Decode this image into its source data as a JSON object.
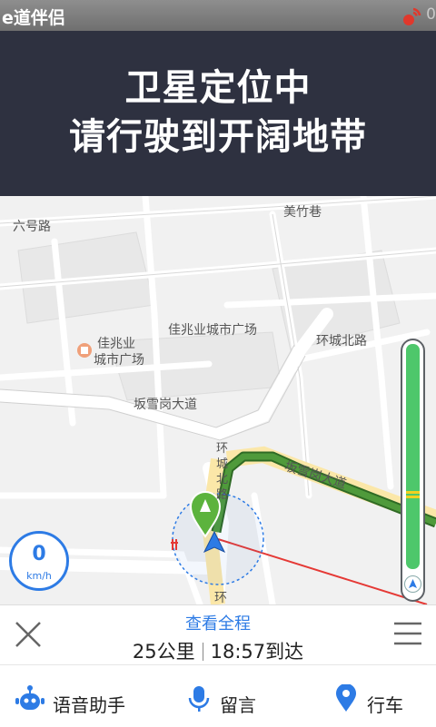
{
  "status_bar": {
    "app_name": "e道伴侣",
    "signal_count": "0"
  },
  "banner": {
    "line1": "卫星定位中",
    "line2": "请行驶到开阔地带"
  },
  "map": {
    "labels": {
      "road_liuhao": "六号路",
      "road_meizhuxiang": "美竹巷",
      "plaza_jiazhaoye": "佳兆业城市广场",
      "poi_jiazhaoye_line1": "佳兆业",
      "poi_jiazhaoye_line2": "城市广场",
      "road_huanchengbei": "环城北路",
      "road_banxuegang": "坂雪岗大道",
      "road_banxuegang_route": "坂雪岗大道",
      "road_huancheng_v": "环城北路",
      "road_huan_bottom": "环"
    },
    "route_color": "#4f9a3b"
  },
  "speedometer": {
    "value": "0",
    "unit": "km/h"
  },
  "route_progress": {
    "level": 0.88
  },
  "nav_panel": {
    "overview_label": "查看全程",
    "distance": "25公里",
    "arrival": "18:57到达"
  },
  "bottom_actions": [
    {
      "label": "语音助手",
      "icon": "robot-assistant-icon"
    },
    {
      "label": "留言",
      "icon": "microphone-icon"
    },
    {
      "label": "行车",
      "icon": "location-pin-icon"
    }
  ],
  "colors": {
    "accent": "#2d7be5",
    "banner_bg": "#2e3140",
    "progress_green": "#4ec76b"
  }
}
